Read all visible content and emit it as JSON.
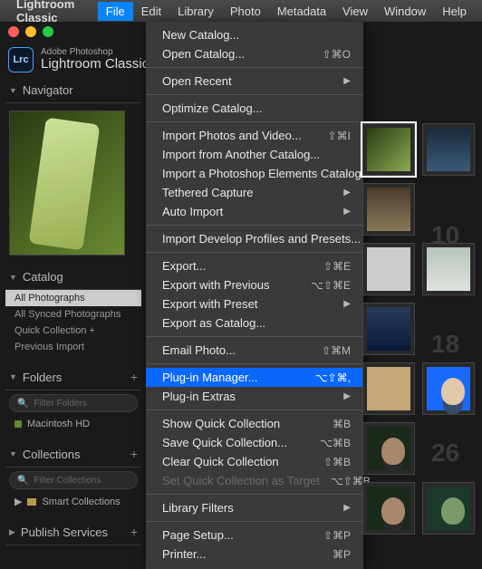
{
  "menubar": {
    "apple": "",
    "appname": "Lightroom Classic",
    "items": [
      "File",
      "Edit",
      "Library",
      "Photo",
      "Metadata",
      "View",
      "Window",
      "Help"
    ],
    "active": "File"
  },
  "brand": {
    "badge": "Lrc",
    "small": "Adobe Photoshop",
    "big": "Lightroom Classic"
  },
  "sidebar": {
    "navigator": "Navigator",
    "catalog": {
      "title": "Catalog",
      "items": [
        "All Photographs",
        "All Synced Photographs",
        "Quick Collection  +",
        "Previous Import"
      ],
      "selected": 0
    },
    "folders": {
      "title": "Folders",
      "filter_ph": "Filter Folders",
      "disk": "Macintosh HD"
    },
    "collections": {
      "title": "Collections",
      "filter_ph": "Filter Collections",
      "smart": "Smart Collections"
    },
    "publish": {
      "title": "Publish Services"
    }
  },
  "grid": {
    "nums": [
      "",
      "10",
      "18",
      "26"
    ]
  },
  "menu": {
    "groups": [
      [
        {
          "l": "New Catalog..."
        },
        {
          "l": "Open Catalog...",
          "s": "⇧⌘O"
        }
      ],
      [
        {
          "l": "Open Recent",
          "sub": true
        }
      ],
      [
        {
          "l": "Optimize Catalog..."
        }
      ],
      [
        {
          "l": "Import Photos and Video...",
          "s": "⇧⌘I"
        },
        {
          "l": "Import from Another Catalog..."
        },
        {
          "l": "Import a Photoshop Elements Catalog..."
        },
        {
          "l": "Tethered Capture",
          "sub": true
        },
        {
          "l": "Auto Import",
          "sub": true
        }
      ],
      [
        {
          "l": "Import Develop Profiles and Presets..."
        }
      ],
      [
        {
          "l": "Export...",
          "s": "⇧⌘E"
        },
        {
          "l": "Export with Previous",
          "s": "⌥⇧⌘E"
        },
        {
          "l": "Export with Preset",
          "sub": true
        },
        {
          "l": "Export as Catalog..."
        }
      ],
      [
        {
          "l": "Email Photo...",
          "s": "⇧⌘M"
        }
      ],
      [
        {
          "l": "Plug-in Manager...",
          "s": "⌥⇧⌘,",
          "hl": true
        },
        {
          "l": "Plug-in Extras",
          "sub": true
        }
      ],
      [
        {
          "l": "Show Quick Collection",
          "s": "⌘B"
        },
        {
          "l": "Save Quick Collection...",
          "s": "⌥⌘B"
        },
        {
          "l": "Clear Quick Collection",
          "s": "⇧⌘B"
        },
        {
          "l": "Set Quick Collection as Target",
          "s": "⌥⇧⌘B",
          "dis": true
        }
      ],
      [
        {
          "l": "Library Filters",
          "sub": true
        }
      ],
      [
        {
          "l": "Page Setup...",
          "s": "⇧⌘P"
        },
        {
          "l": "Printer...",
          "s": "⌘P"
        }
      ]
    ]
  }
}
